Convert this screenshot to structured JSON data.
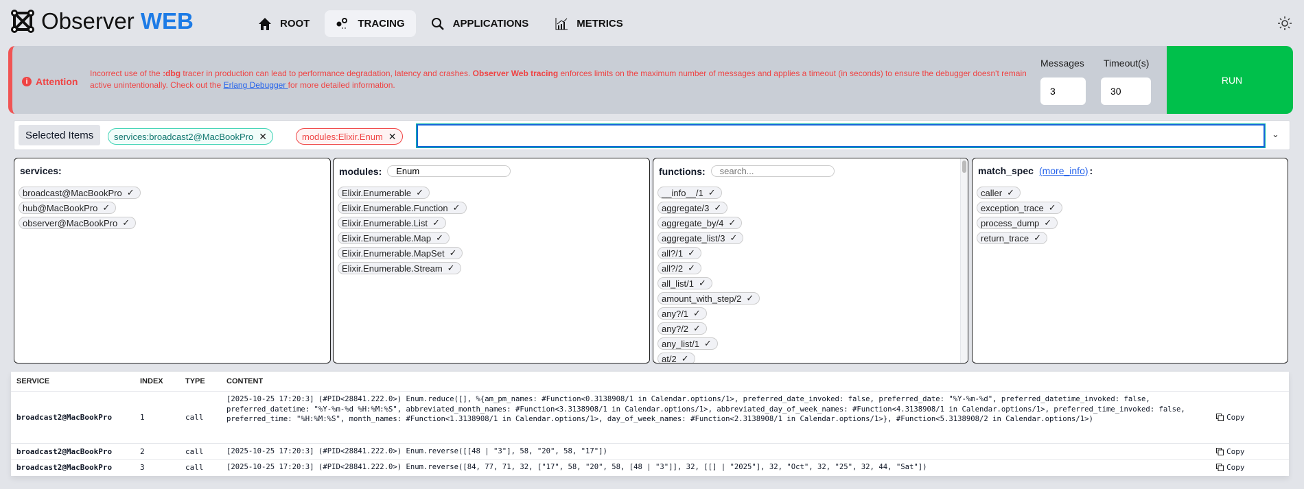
{
  "header": {
    "logo_main": "Observer",
    "logo_accent": "WEB",
    "nav": [
      {
        "label": "ROOT",
        "icon": "home-icon"
      },
      {
        "label": "TRACING",
        "icon": "tracing-icon"
      },
      {
        "label": "APPLICATIONS",
        "icon": "search-icon"
      },
      {
        "label": "METRICS",
        "icon": "chart-icon"
      }
    ],
    "theme_icon": "sun-icon"
  },
  "banner": {
    "title": "Attention",
    "text1": "Incorrect use of the ",
    "bold1": ":dbg",
    "text2": " tracer in production can lead to performance degradation, latency and crashes. ",
    "bold2": "Observer Web tracing",
    "text3": " enforces limits on the maximum number of messages and applies a timeout (in seconds) to ensure the debugger doesn't remain active unintentionally. Check out the ",
    "link": "Erlang Debugger ",
    "text4": "for more detailed information.",
    "messages_label": "Messages",
    "messages_value": "3",
    "timeout_label": "Timeout(s)",
    "timeout_value": "30",
    "run_label": "RUN"
  },
  "selected": {
    "label": "Selected Items",
    "chips": [
      "services:broadcast2@MacBookPro",
      "modules:Elixir.Enum"
    ],
    "remove": "✕",
    "input_value": "",
    "caret": "⌄"
  },
  "panels": {
    "services": {
      "title": "services:",
      "items": [
        "broadcast@MacBookPro",
        "hub@MacBookPro",
        "observer@MacBookPro"
      ]
    },
    "modules": {
      "title": "modules:",
      "search_value": "Enum",
      "items": [
        "Elixir.Enumerable",
        "Elixir.Enumerable.Function",
        "Elixir.Enumerable.List",
        "Elixir.Enumerable.Map",
        "Elixir.Enumerable.MapSet",
        "Elixir.Enumerable.Stream"
      ]
    },
    "functions": {
      "title": "functions:",
      "search_placeholder": "search...",
      "items": [
        "__info__/1",
        "aggregate/3",
        "aggregate_by/4",
        "aggregate_list/3",
        "all?/1",
        "all?/2",
        "all_list/1",
        "amount_with_step/2",
        "any?/1",
        "any?/2",
        "any_list/1",
        "at/2"
      ]
    },
    "match_spec": {
      "title": "match_spec",
      "link": "(more_info)",
      "suffix": ":",
      "items": [
        "caller",
        "exception_trace",
        "process_dump",
        "return_trace"
      ]
    },
    "check": "✓"
  },
  "table": {
    "headers": [
      "SERVICE",
      "INDEX",
      "TYPE",
      "CONTENT"
    ],
    "copy_label": "Copy",
    "rows": [
      {
        "service": "broadcast2@MacBookPro",
        "index": "1",
        "type": "call",
        "content": "[2025-10-25 17:20:3] (#PID<28841.222.0>) Enum.reduce([], %{am_pm_names: #Function<0.3138908/1 in Calendar.options/1>, preferred_date_invoked: false, preferred_date: \"%Y-%m-%d\", preferred_datetime_invoked: false, preferred_datetime: \"%Y-%m-%d %H:%M:%S\", abbreviated_month_names: #Function<3.3138908/1 in Calendar.options/1>, abbreviated_day_of_week_names: #Function<4.3138908/1 in Calendar.options/1>, preferred_time_invoked: false, preferred_time: \"%H:%M:%S\", month_names: #Function<1.3138908/1 in Calendar.options/1>, day_of_week_names: #Function<2.3138908/1 in Calendar.options/1>}, #Function<5.3138908/2 in Calendar.options/1>)"
      },
      {
        "service": "broadcast2@MacBookPro",
        "index": "2",
        "type": "call",
        "content": "[2025-10-25 17:20:3] (#PID<28841.222.0>) Enum.reverse([[48 | \"3\"], 58, \"20\", 58, \"17\"])"
      },
      {
        "service": "broadcast2@MacBookPro",
        "index": "3",
        "type": "call",
        "content": "[2025-10-25 17:20:3] (#PID<28841.222.0>) Enum.reverse([84, 77, 71, 32, [\"17\", 58, \"20\", 58, [48 | \"3\"]], 32, [[] | \"2025\"], 32, \"Oct\", 32, \"25\", 32, 44, \"Sat\"])"
      }
    ]
  }
}
